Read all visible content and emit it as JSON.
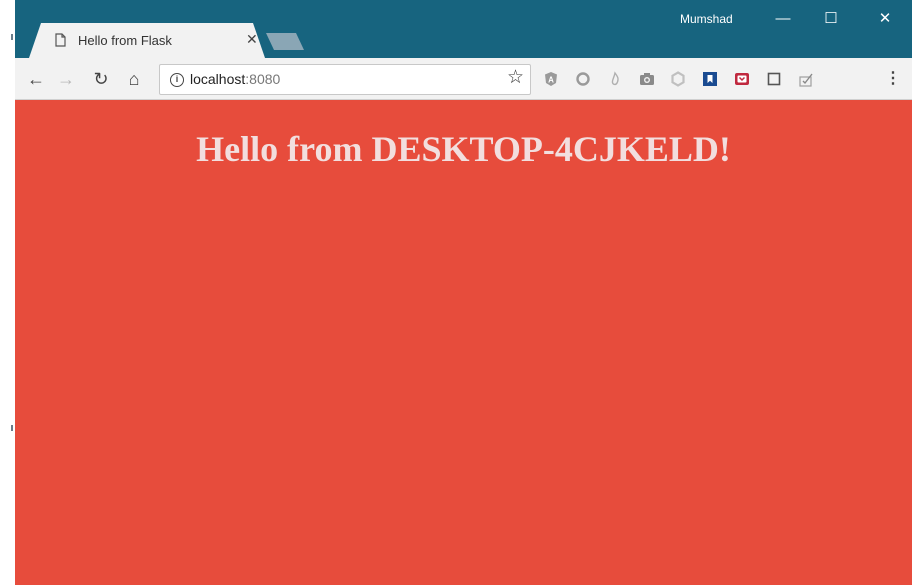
{
  "browser": {
    "tab": {
      "title": "Hello from Flask",
      "close_label": "✕"
    },
    "profile_name": "Mumshad",
    "window_controls": {
      "minimize": "—",
      "maximize": "☐",
      "close": "✕"
    },
    "address_bar": {
      "host": "localhost",
      "port": ":8080"
    },
    "extensions": [
      "angular-icon",
      "circle-icon",
      "flame-icon",
      "camera-icon",
      "hexagon-icon",
      "bookmark-icon",
      "pocket-icon",
      "square-icon",
      "checklist-icon"
    ]
  },
  "page": {
    "heading": "Hello from DESKTOP-4CJKELD!",
    "background_color": "#e74c3c"
  }
}
